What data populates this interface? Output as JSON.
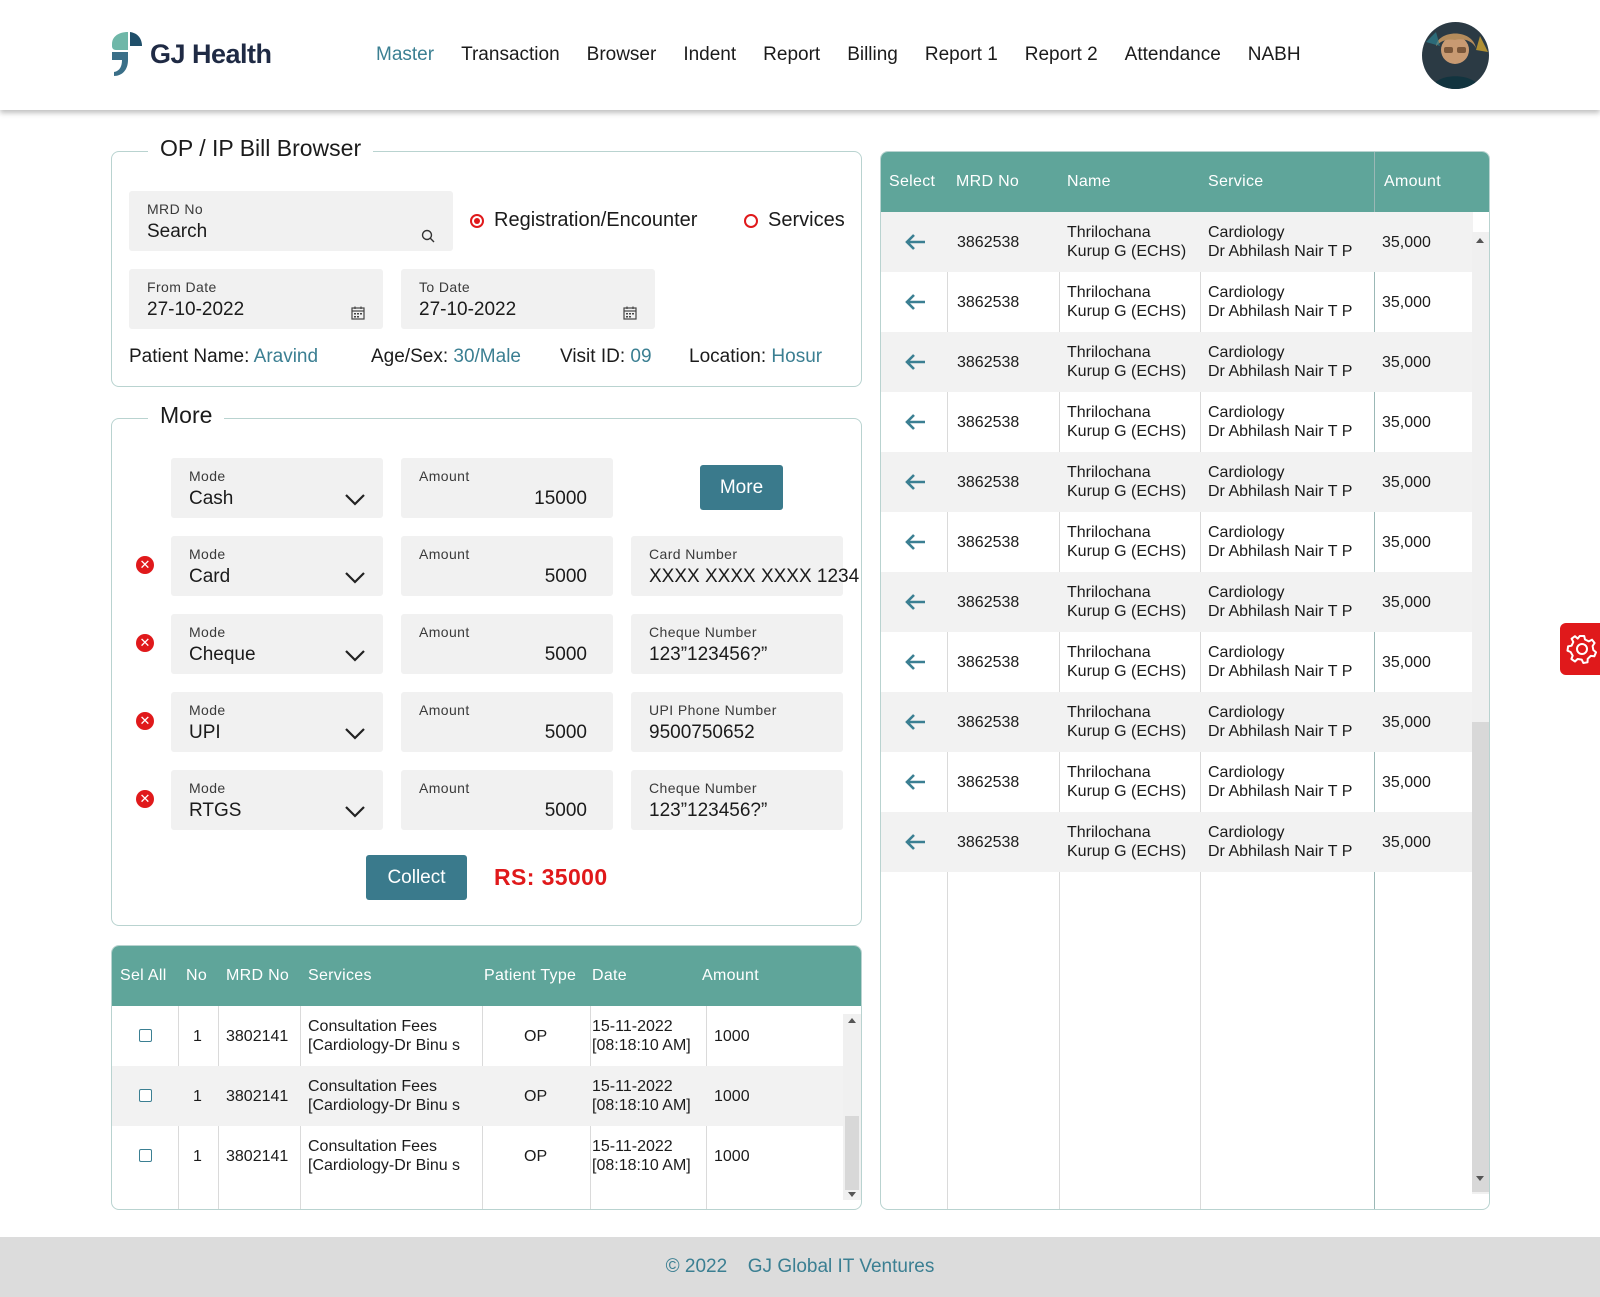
{
  "header": {
    "logo_text": "GJ Health",
    "nav": [
      "Master",
      "Transaction",
      "Browser",
      "Indent",
      "Report",
      "Billing",
      "Report 1",
      "Report 2",
      "Attendance",
      "NABH"
    ],
    "active_nav": "Master"
  },
  "bill_browser": {
    "title": "OP / IP Bill Browser",
    "mrd_label": "MRD No",
    "mrd_value": "Search",
    "radio_registration": "Registration/Encounter",
    "radio_services": "Services",
    "from_label": "From Date",
    "from_value": "27-10-2022",
    "to_label": "To Date",
    "to_value": "27-10-2022",
    "patient_name_label": "Patient Name:",
    "patient_name": "Aravind",
    "age_sex_label": "Age/Sex:",
    "age_sex": "30/Male",
    "visit_label": "Visit ID:",
    "visit_id": "09",
    "location_label": "Location:",
    "location": "Hosur"
  },
  "more": {
    "title": "More",
    "more_button": "More",
    "collect_button": "Collect",
    "total": "RS: 35000",
    "mode_label": "Mode",
    "amount_label": "Amount",
    "rows": [
      {
        "mode": "Cash",
        "amount": "15000",
        "extra_label": "",
        "extra_value": ""
      },
      {
        "mode": "Card",
        "amount": "5000",
        "extra_label": "Card Number",
        "extra_value": "XXXX XXXX XXXX 1234"
      },
      {
        "mode": "Cheque",
        "amount": "5000",
        "extra_label": "Cheque Number",
        "extra_value": "123”123456?”"
      },
      {
        "mode": "UPI",
        "amount": "5000",
        "extra_label": "UPI Phone Number",
        "extra_value": "9500750652"
      },
      {
        "mode": "RTGS",
        "amount": "5000",
        "extra_label": "Cheque Number",
        "extra_value": "123”123456?”"
      }
    ]
  },
  "services_table": {
    "headers": [
      "Sel All",
      "No",
      "MRD No",
      "Services",
      "Patient Type",
      "Date",
      "Amount"
    ],
    "rows": [
      {
        "no": "1",
        "mrd": "3802141",
        "service_1": "Consultation Fees",
        "service_2": "[Cardiology-Dr Binu s",
        "type": "OP",
        "date_1": "15-11-2022",
        "date_2": "[08:18:10 AM]",
        "amount": "1000"
      },
      {
        "no": "1",
        "mrd": "3802141",
        "service_1": "Consultation Fees",
        "service_2": "[Cardiology-Dr Binu s",
        "type": "OP",
        "date_1": "15-11-2022",
        "date_2": "[08:18:10 AM]",
        "amount": "1000"
      },
      {
        "no": "1",
        "mrd": "3802141",
        "service_1": "Consultation Fees",
        "service_2": "[Cardiology-Dr Binu s",
        "type": "OP",
        "date_1": "15-11-2022",
        "date_2": "[08:18:10 AM]",
        "amount": "1000"
      }
    ]
  },
  "patients_table": {
    "headers": [
      "Select",
      "MRD No",
      "Name",
      "Service",
      "Amount"
    ],
    "rows": [
      {
        "mrd": "3862538",
        "name_1": "Thrilochana",
        "name_2": "Kurup G (ECHS)",
        "service_1": "Cardiology",
        "service_2": "Dr Abhilash Nair T P",
        "amount": "35,000"
      },
      {
        "mrd": "3862538",
        "name_1": "Thrilochana",
        "name_2": "Kurup G (ECHS)",
        "service_1": "Cardiology",
        "service_2": "Dr Abhilash Nair T P",
        "amount": "35,000"
      },
      {
        "mrd": "3862538",
        "name_1": "Thrilochana",
        "name_2": "Kurup G (ECHS)",
        "service_1": "Cardiology",
        "service_2": "Dr Abhilash Nair T P",
        "amount": "35,000"
      },
      {
        "mrd": "3862538",
        "name_1": "Thrilochana",
        "name_2": "Kurup G (ECHS)",
        "service_1": "Cardiology",
        "service_2": "Dr Abhilash Nair T P",
        "amount": "35,000"
      },
      {
        "mrd": "3862538",
        "name_1": "Thrilochana",
        "name_2": "Kurup G (ECHS)",
        "service_1": "Cardiology",
        "service_2": "Dr Abhilash Nair T P",
        "amount": "35,000"
      },
      {
        "mrd": "3862538",
        "name_1": "Thrilochana",
        "name_2": "Kurup G (ECHS)",
        "service_1": "Cardiology",
        "service_2": "Dr Abhilash Nair T P",
        "amount": "35,000"
      },
      {
        "mrd": "3862538",
        "name_1": "Thrilochana",
        "name_2": "Kurup G (ECHS)",
        "service_1": "Cardiology",
        "service_2": "Dr Abhilash Nair T P",
        "amount": "35,000"
      },
      {
        "mrd": "3862538",
        "name_1": "Thrilochana",
        "name_2": "Kurup G (ECHS)",
        "service_1": "Cardiology",
        "service_2": "Dr Abhilash Nair T P",
        "amount": "35,000"
      },
      {
        "mrd": "3862538",
        "name_1": "Thrilochana",
        "name_2": "Kurup G (ECHS)",
        "service_1": "Cardiology",
        "service_2": "Dr Abhilash Nair T P",
        "amount": "35,000"
      },
      {
        "mrd": "3862538",
        "name_1": "Thrilochana",
        "name_2": "Kurup G (ECHS)",
        "service_1": "Cardiology",
        "service_2": "Dr Abhilash Nair T P",
        "amount": "35,000"
      },
      {
        "mrd": "3862538",
        "name_1": "Thrilochana",
        "name_2": "Kurup G (ECHS)",
        "service_1": "Cardiology",
        "service_2": "Dr Abhilash Nair T P",
        "amount": "35,000"
      }
    ]
  },
  "footer": {
    "year": "2022",
    "company": "GJ Global IT Ventures"
  },
  "colors": {
    "accent": "#3b7f92",
    "table_header": "#5fa59a",
    "danger": "#e0191b"
  }
}
